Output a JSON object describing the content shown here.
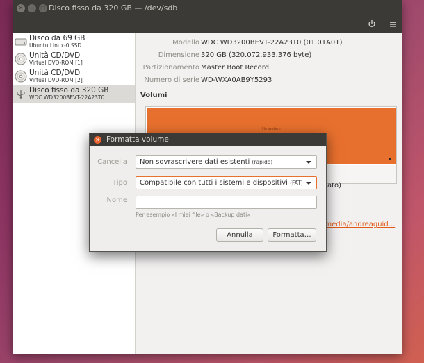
{
  "window": {
    "title": "Disco fisso da 320 GB — /dev/sdb",
    "controls": [
      "close-icon",
      "minimize-icon",
      "maximize-icon"
    ]
  },
  "headerbar": {
    "icons": [
      "power-icon",
      "menu-icon"
    ]
  },
  "sidebar": {
    "items": [
      {
        "name": "Disco da 69 GB",
        "sub": "Ubuntu Linux-0 SSD",
        "icon": "hard-drive-icon"
      },
      {
        "name": "Unità CD/DVD",
        "sub": "Virtual DVD-ROM [1]",
        "icon": "optical-disc-icon"
      },
      {
        "name": "Unità CD/DVD",
        "sub": "Virtual DVD-ROM [2]",
        "icon": "optical-disc-icon"
      },
      {
        "name": "Disco fisso da 320 GB",
        "sub": "WDC WD3200BEVT-22A23T0",
        "icon": "usb-drive-icon",
        "selected": true
      }
    ]
  },
  "details": {
    "rows": [
      {
        "label": "Modello",
        "value": "WDC WD3200BEVT-22A23T0 (01.01A01)"
      },
      {
        "label": "Dimensione",
        "value": "320 GB (320.072.933.376 byte)"
      },
      {
        "label": "Partizionamento",
        "value": "Master Boot Record"
      },
      {
        "label": "Numero di serie",
        "value": "WD-WXA0AB9Y5293"
      }
    ],
    "volumes_heading": "Volumi",
    "partition_label": "file system",
    "partially_visible_text": "ato)",
    "partially_visible_link": "/media/andreaguid..."
  },
  "dialog": {
    "title": "Formatta volume",
    "erase_label": "Cancella",
    "erase_value": "Non sovrascrivere dati esistenti",
    "erase_value_note": "(rapido)",
    "type_label": "Tipo",
    "type_value": "Compatibile con tutti i sistemi e dispositivi",
    "type_value_note": "(FAT)",
    "name_label": "Nome",
    "name_value": "",
    "name_hint": "Per esempio «I miei file» o «Backup dati»",
    "cancel_button": "Annulla",
    "format_button": "Formatta…"
  },
  "colors": {
    "accent": "#e8702e",
    "titlebar": "#3b3a36",
    "window_bg": "#f2f1f0"
  }
}
